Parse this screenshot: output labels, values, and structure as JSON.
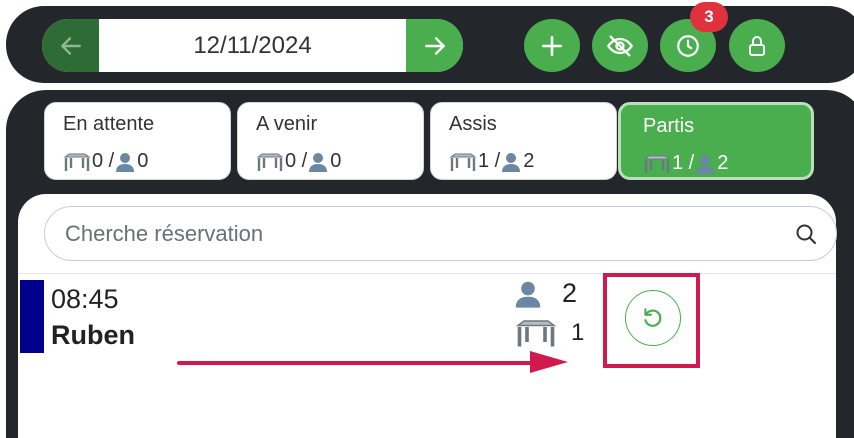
{
  "header": {
    "date": "12/11/2024",
    "prev_icon": "arrow-left-icon",
    "next_icon": "arrow-right-icon",
    "actions": [
      {
        "name": "add",
        "icon": "plus-icon"
      },
      {
        "name": "hide",
        "icon": "eye-off-icon"
      },
      {
        "name": "history",
        "icon": "clock-icon",
        "badge": "3"
      },
      {
        "name": "lock",
        "icon": "lock-icon"
      }
    ]
  },
  "status_cards": [
    {
      "title": "En attente",
      "tables": "0",
      "guests": "0",
      "active": false
    },
    {
      "title": "A venir",
      "tables": "0",
      "guests": "0",
      "active": false
    },
    {
      "title": "Assis",
      "tables": "1",
      "guests": "2",
      "active": false
    },
    {
      "title": "Partis",
      "tables": "1",
      "guests": "2",
      "active": true
    }
  ],
  "search": {
    "placeholder": "Cherche réservation",
    "value": ""
  },
  "reservations": [
    {
      "time": "08:45",
      "name": "Ruben",
      "guests": "2",
      "tables": "1",
      "color": "#00008b"
    }
  ],
  "colors": {
    "accent": "#4aae4f",
    "dark": "#23272b",
    "badge": "#e0313e",
    "highlight": "#d01a4f"
  }
}
